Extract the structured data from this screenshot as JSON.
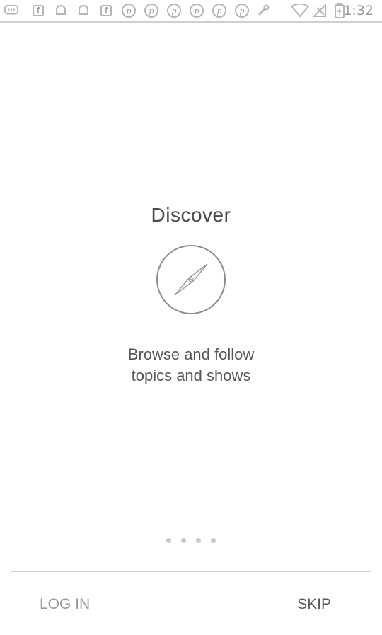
{
  "status_bar": {
    "icons": [
      "chat-bubble-icon",
      "facebook-icon",
      "android-icon",
      "android-icon",
      "facebook-icon",
      "pinterest-icon",
      "pinterest-icon",
      "pinterest-icon",
      "pinterest-icon",
      "pinterest-icon",
      "pinterest-icon",
      "wrench-icon",
      "wifi-icon",
      "no-signal-icon",
      "battery-charging-icon"
    ],
    "time": "1:32"
  },
  "onboarding": {
    "title": "Discover",
    "description_line1": "Browse and follow",
    "description_line2": "topics and shows",
    "page_count": 4,
    "current_page": 1
  },
  "footer": {
    "login_label": "LOG IN",
    "skip_label": "SKIP"
  }
}
